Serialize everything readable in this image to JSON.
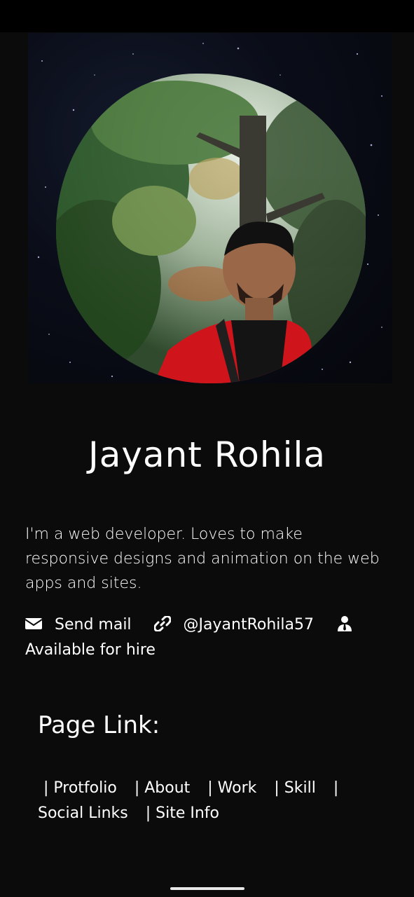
{
  "profile": {
    "name": "Jayant Rohila",
    "bio": "I'm a web developer. Loves to make responsive designs and animation on the web apps and sites."
  },
  "contacts": {
    "mail_icon": "envelope-icon",
    "mail_label": "Send mail",
    "link_icon": "link-icon",
    "handle": "@JayantRohila57",
    "hire_icon": "user-tie-icon",
    "hire_label": "Available for hire"
  },
  "page_links": {
    "title": "Page Link:",
    "items": [
      {
        "label": "| Protfolio"
      },
      {
        "label": "| About"
      },
      {
        "label": "| Work"
      },
      {
        "label": "| Skill"
      },
      {
        "label": "|"
      },
      {
        "label": "Social Links"
      },
      {
        "label": "| Site Info"
      }
    ]
  },
  "colors": {
    "background": "#0b0b0c",
    "text": "#ffffff",
    "jacket": "#d0141c"
  }
}
